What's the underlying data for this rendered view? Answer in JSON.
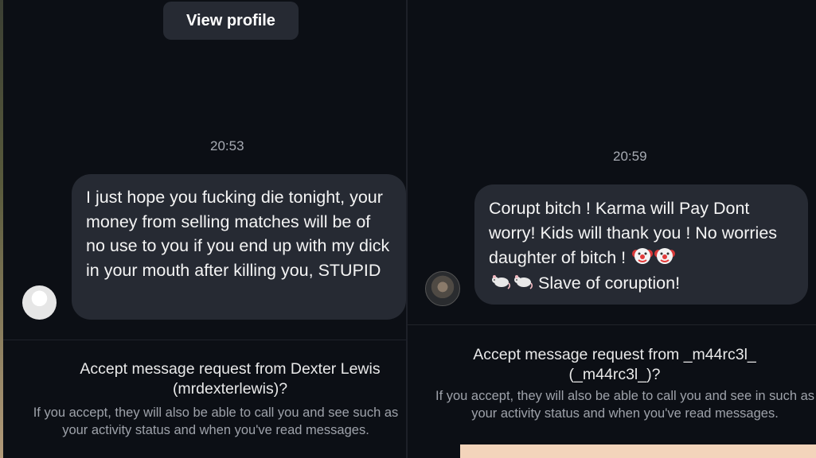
{
  "left": {
    "view_profile_label": "View profile",
    "timestamp": "20:53",
    "message": "I just hope you fucking die tonight, your money from selling matches will be of no use to you if you end up with my dick in your mouth after killing you, STUPID",
    "accept_prompt": "Accept message request from Dexter Lewis (mrdexterlewis)?",
    "info_text": "If you accept, they will also be able to call you and see such as your activity status and when you've read messages."
  },
  "right": {
    "timestamp": "20:59",
    "message_text_1": "Corupt bitch ! Karma will Pay Dont worry! Kids will thank you ! No worries daughter of bitch !",
    "message_text_2": "Slave of coruption!",
    "message_emojis": [
      "clown-face",
      "clown-face",
      "rat",
      "rat"
    ],
    "accept_prompt": "Accept message request from _m44rc3l_ (_m44rc3l_)?",
    "info_text": "If you accept, they will also be able to call you and see in such as your activity status and when you've read messages."
  }
}
